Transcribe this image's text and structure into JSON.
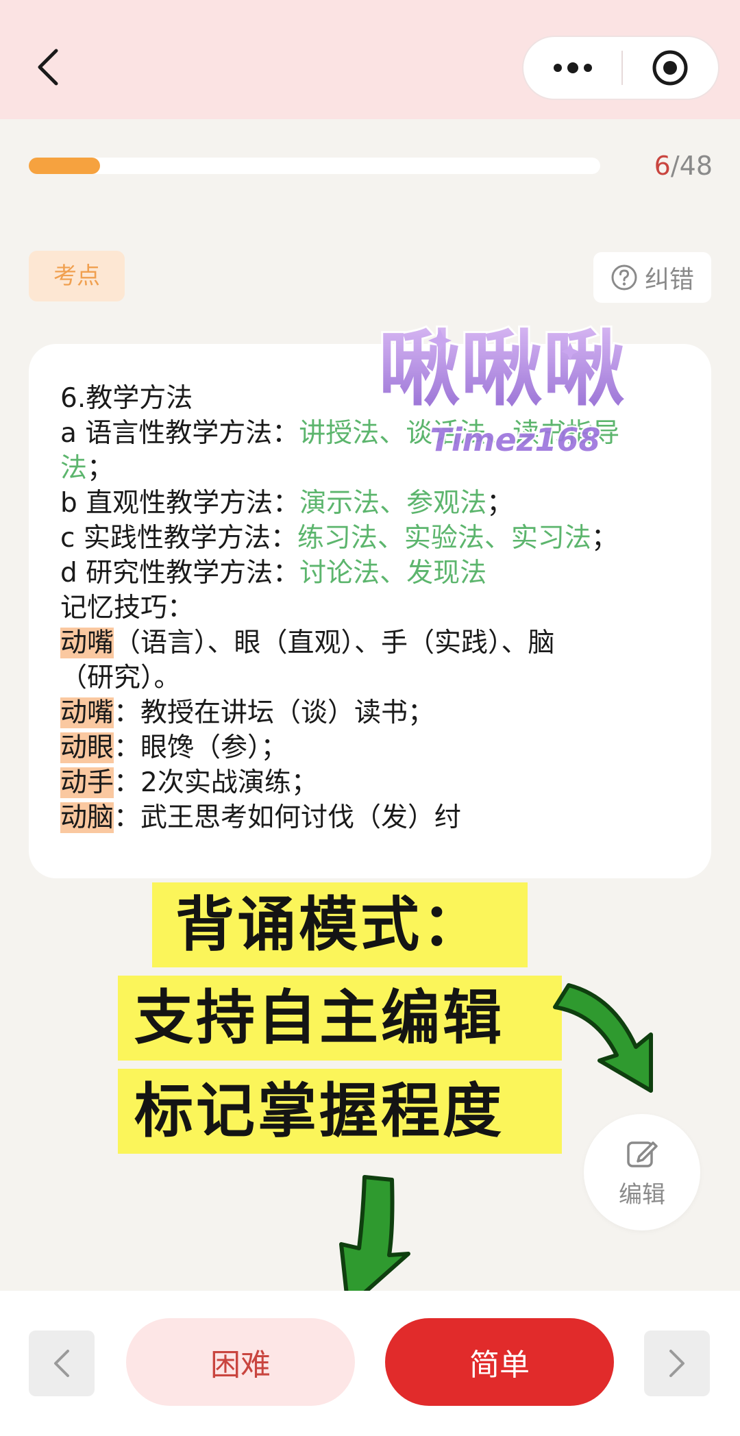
{
  "header": {
    "back_icon": "chevron-left-icon",
    "more_icon": "more-dots-icon",
    "target_icon": "target-icon"
  },
  "progress": {
    "current": "6",
    "separator": "/",
    "total": "48",
    "fraction": 0.125,
    "fill_color": "#f6a23f"
  },
  "tags": {
    "category": "考点",
    "report_label": "纠错",
    "report_icon": "question-circle-icon"
  },
  "card": {
    "title": "6.教学方法",
    "methods": [
      {
        "prefix": "a 语言性教学方法：",
        "value": "讲授法、谈话法、读书指导",
        "value_cont": "法",
        "suffix": "；"
      },
      {
        "prefix": "b 直观性教学方法：",
        "value": "演示法、参观法",
        "suffix": "；"
      },
      {
        "prefix": "c 实践性教学方法：",
        "value": "练习法、实验法、实习法",
        "suffix": "；"
      },
      {
        "prefix": "d 研究性教学方法：",
        "value": "讨论法、发现法",
        "suffix": ""
      }
    ],
    "tips_heading": "记忆技巧：",
    "tips_line1_hl": "动嘴",
    "tips_line1_rest": "（语言）、眼（直观）、手（实践）、脑",
    "tips_line2": "（研究）。",
    "mnemonics": [
      {
        "hl": "动嘴",
        "text": "：教授在讲坛（谈）读书；"
      },
      {
        "hl": "动眼",
        "text": "：眼馋（参）；"
      },
      {
        "hl": "动手",
        "text": "：2次实战演练；"
      },
      {
        "hl": "动脑",
        "text": "：武王思考如何讨伐（发）纣"
      }
    ]
  },
  "watermark": {
    "title": "啾啾啾",
    "subtitle": "Timez168"
  },
  "promo": {
    "line1": "背诵模式：",
    "line2": "支持自主编辑",
    "line3": "标记掌握程度",
    "highlight_color": "#fbf55a",
    "arrow_color": "#2f9a2f"
  },
  "edit_fab": {
    "icon": "edit-icon",
    "label": "编辑"
  },
  "bottom": {
    "prev_icon": "chevron-left-icon",
    "next_icon": "chevron-right-icon",
    "hard_label": "困难",
    "easy_label": "简单"
  }
}
